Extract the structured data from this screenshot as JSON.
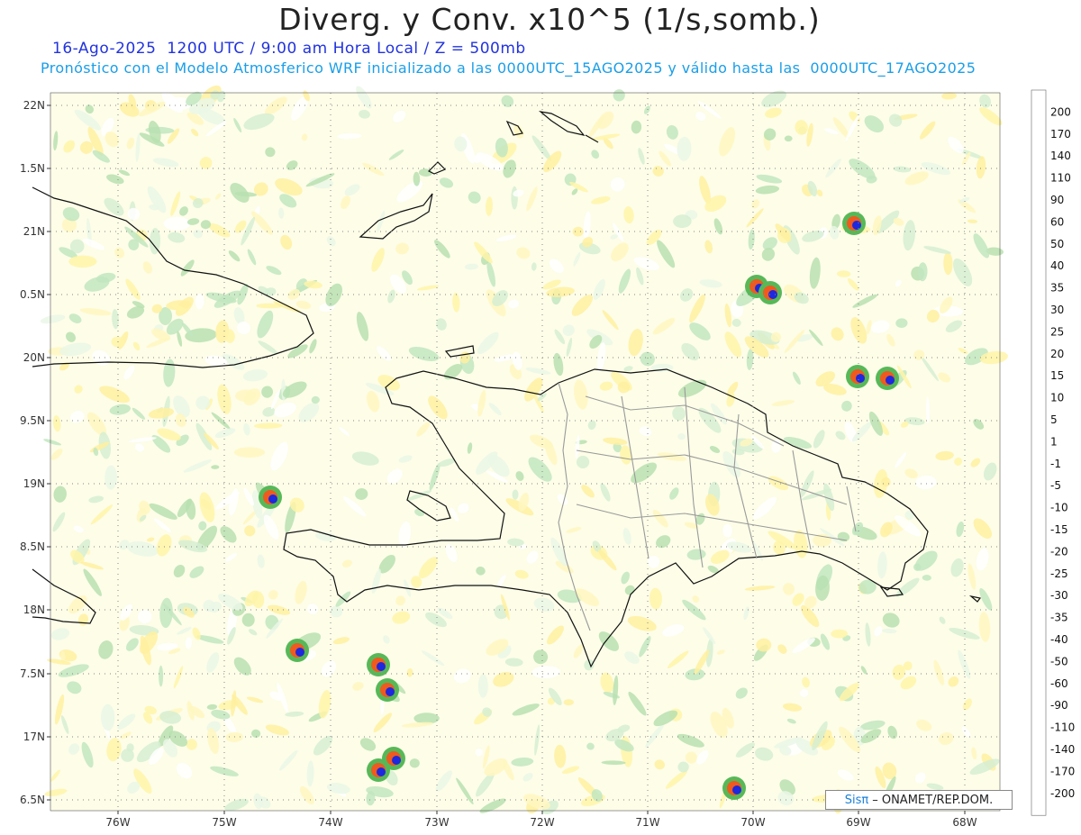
{
  "header": {
    "title": "Diverg. y Conv. x10^5 (1/s,somb.)",
    "line1": "16-Ago-2025  1200 UTC / 9:00 am Hora Local / Z = 500mb",
    "line2": "Pronóstico con el Modelo Atmosferico WRF inicializado a las 0000UTC_15AGO2025 y válido hasta las  0000UTC_17AGO2025"
  },
  "axes": {
    "lat_labels": [
      "22N",
      "1.5N",
      "21N",
      "0.5N",
      "20N",
      "9.5N",
      "19N",
      "8.5N",
      "18N",
      "7.5N",
      "17N",
      "6.5N"
    ],
    "lon_labels": [
      "76W",
      "75W",
      "74W",
      "73W",
      "72W",
      "71W",
      "70W",
      "69W",
      "68W"
    ]
  },
  "colorbar": {
    "levels": [
      "200",
      "170",
      "140",
      "110",
      "90",
      "60",
      "50",
      "40",
      "35",
      "30",
      "25",
      "20",
      "15",
      "10",
      "5",
      "1",
      "-1",
      "-5",
      "-10",
      "-15",
      "-20",
      "-25",
      "-30",
      "-35",
      "-40",
      "-50",
      "-60",
      "-90",
      "-110",
      "-140",
      "-170",
      "-200"
    ],
    "colors": [
      "#ffffff",
      "#e8141e",
      "#f0321e",
      "#f55a1e",
      "#fa7814",
      "#fa9614",
      "#ffb414",
      "#ffd21e",
      "#ffe632",
      "#fff050",
      "#fff578",
      "#fffa96",
      "#fffab4",
      "#fffcc8",
      "#fffde0",
      "#fffeee",
      "#ffffff",
      "#eaf7ea",
      "#c8ecc8",
      "#a0dca0",
      "#78c878",
      "#50b450",
      "#28a028",
      "#14961e",
      "#0a7846",
      "#086478",
      "#0a50a0",
      "#0a3cc8",
      "#1e28dc",
      "#2814b4",
      "#321496",
      "#3c1482",
      "#500a96"
    ]
  },
  "credit": {
    "brand": "Sisπ",
    "text": "– ONAMET/REP.DOM."
  }
}
